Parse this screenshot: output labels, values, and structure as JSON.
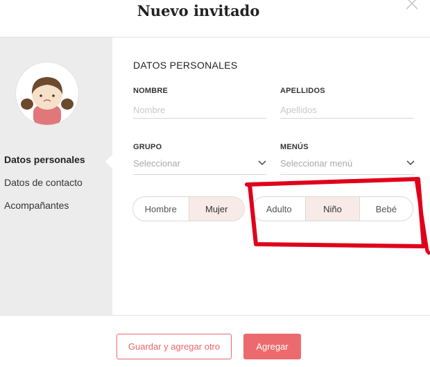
{
  "modal": {
    "title": "Nuevo invitado"
  },
  "sidebar": {
    "items": [
      {
        "label": "Datos personales",
        "active": true
      },
      {
        "label": "Datos de contacto",
        "active": false
      },
      {
        "label": "Acompañantes",
        "active": false
      }
    ]
  },
  "form": {
    "section_title": "DATOS PERSONALES",
    "nombre": {
      "label": "NOMBRE",
      "placeholder": "Nombre",
      "value": ""
    },
    "apellidos": {
      "label": "APELLIDOS",
      "placeholder": "Apellidos",
      "value": ""
    },
    "grupo": {
      "label": "GRUPO",
      "placeholder": "Seleccionar"
    },
    "menus": {
      "label": "MENÚS",
      "placeholder": "Seleccionar menú"
    },
    "sexo": {
      "options": [
        "Hombre",
        "Mujer"
      ],
      "selected": "Mujer"
    },
    "edad": {
      "options": [
        "Adulto",
        "Niño",
        "Bebé"
      ],
      "selected": "Niño"
    }
  },
  "footer": {
    "secondary_label": "Guardar y agregar otro",
    "primary_label": "Agregar"
  },
  "colors": {
    "accent": "#ec6a6d",
    "selected_bg": "#f8ebe7",
    "sidebar_bg": "#ececec",
    "annotation": "#e0001b"
  },
  "icons": [
    "close-icon",
    "chevron-down-icon",
    "girl-avatar-icon"
  ]
}
